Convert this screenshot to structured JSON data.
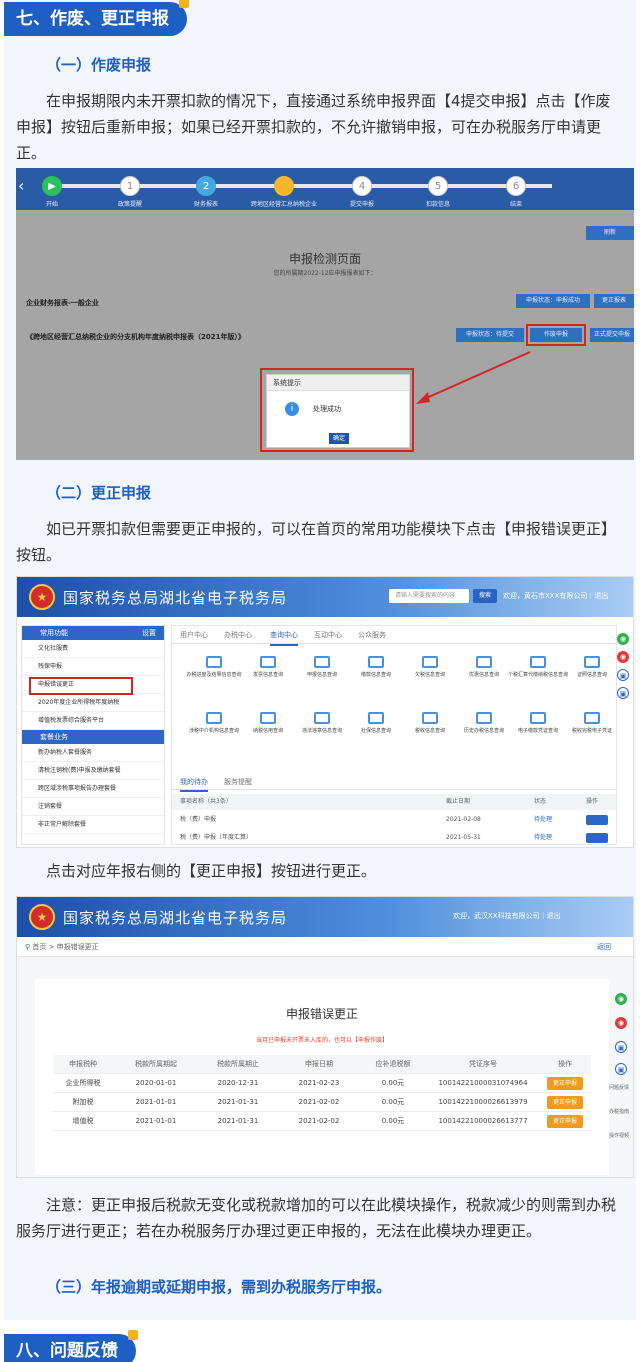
{
  "section7": {
    "title": "七、作废、更正申报"
  },
  "part1": {
    "heading": "（一）作废申报",
    "text": "在申报期限内未开票扣款的情况下，直接通过系统申报界面【4提交申报】点击【作废申报】按钮后重新申报；如果已经开票扣款的，不允许撤销申报，可在办税服务厅申请更正。",
    "shot": {
      "steps": [
        {
          "num": "",
          "label": "开始"
        },
        {
          "num": "1",
          "label": "政策提醒"
        },
        {
          "num": "2",
          "label": "财务报表"
        },
        {
          "num": "3",
          "label": "跨地区经营汇总纳税企业"
        },
        {
          "num": "4",
          "label": "提交申报"
        },
        {
          "num": "5",
          "label": "扣款信息"
        },
        {
          "num": "6",
          "label": "结束"
        }
      ],
      "refresh": "刷新",
      "title": "申报检测页面",
      "subtitle": "您的所属期2022-12应申报报表如下：",
      "row1": "企业财务报表-一般企业",
      "row1_status": "申报状态：申报成功",
      "row1_btn": "更正报表",
      "row2": "《跨地区经营汇总纳税企业的分支机构年度纳税申报表（2021年版）》",
      "row2_status": "申报状态：待提交",
      "row2_btn": "作废申报",
      "row2_btn2": "正式提交申报",
      "modal_title": "系统提示",
      "modal_text": "处理成功",
      "modal_ok": "确定"
    }
  },
  "part2": {
    "heading": "（二）更正申报",
    "text": "如已开票扣款但需要更正申报的，可以在首页的常用功能模块下点击【申报错误更正】按钮。",
    "shot": {
      "brand": "国家税务总局湖北省电子税务局",
      "search_placeholder": "请输入需要搜索的内容",
      "search_btn": "搜索",
      "welcome": "欢迎，黄石市XXX有限公司｜退出",
      "side_h1": "常用功能",
      "side_h1_r": "设置",
      "side_items": [
        "文化社服费",
        "残保申报",
        "申报错误更正",
        "2020年度企业所得税年度纳税",
        "增值税发票综合服务平台"
      ],
      "side_h2": "套餐业务",
      "side_items2": [
        "新办纳税人套餐服务",
        "清税注销税(费)申报及缴纳套餐",
        "跨区域涉税事项报告办理套餐",
        "注销套餐",
        "非正常户解除套餐"
      ],
      "tabs": [
        "用户中心",
        "办税中心",
        "查询中心",
        "互动中心",
        "公众服务"
      ],
      "icons_row1": [
        "办税进度及结果信息查询",
        "发票信息查询",
        "申报信息查询",
        "缴款信息查询",
        "欠税信息查询",
        "优惠信息查询",
        "个税汇算代缴纳税信息查询",
        "证照信息查询"
      ],
      "icons_row2": [
        "涉税中介机构信息查询",
        "纳税信用查询",
        "违法违章信息查询",
        "社保信息查询",
        "税收信息查询",
        "历史办税信息查询",
        "电子缴款凭证查询",
        "税收完税电子凭证"
      ],
      "todo_tabs": [
        "我的待办",
        "服务提醒"
      ],
      "table_head": [
        "事项名称（共3条）",
        "截止日期",
        "状态",
        "操作"
      ],
      "rows": [
        {
          "name": "税（费）申报",
          "date": "2021-02-08",
          "status": "待处理"
        },
        {
          "name": "税（费）申报（年度汇算）",
          "date": "2021-05-31",
          "status": "待处理"
        }
      ]
    }
  },
  "part2b": {
    "text": "点击对应年报右侧的【更正申报】按钮进行更正。",
    "shot": {
      "brand": "国家税务总局湖北省电子税务局",
      "welcome": "欢迎，武汉XX科技有限公司｜退出",
      "crumb": "首页 > 申报错误更正",
      "back": "返回",
      "title": "申报错误更正",
      "warn": "当月已申报未开票未入库的，也可以【申报作废】",
      "headers": [
        "申报税种",
        "税款所属期起",
        "税款所属期止",
        "申报日期",
        "应补退税额",
        "凭证序号",
        "操作"
      ],
      "rows": [
        [
          "企业所得税",
          "2020-01-01",
          "2020-12-31",
          "2021-02-23",
          "0.00元",
          "10014221000031074964",
          "更正申报"
        ],
        [
          "附加税",
          "2021-01-01",
          "2021-01-31",
          "2021-02-02",
          "0.00元",
          "10014221000026613979",
          "更正申报"
        ],
        [
          "增值税",
          "2021-01-01",
          "2021-01-31",
          "2021-02-02",
          "0.00元",
          "10014221000026613777",
          "更正申报"
        ]
      ],
      "side": [
        "问题反馈",
        "办税指南",
        "操作视频"
      ]
    }
  },
  "note": "注意：更正申报后税款无变化或税款增加的可以在此模块操作，税款减少的则需到办税服务厅进行更正；若在办税服务厅办理过更正申报的，无法在此模块办理更正。",
  "part3": {
    "heading": "（三）年报逾期或延期申报，需到办税服务厅申报。"
  },
  "section8": {
    "title": "八、问题反馈"
  }
}
